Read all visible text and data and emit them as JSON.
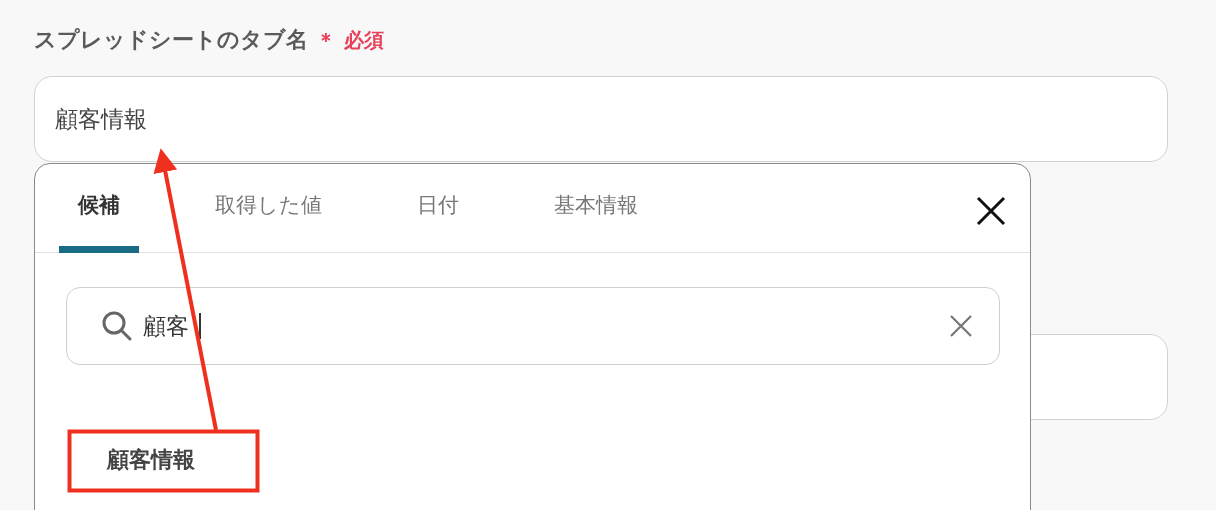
{
  "field": {
    "label": "スプレッドシートのタブ名",
    "required_mark": "＊",
    "required_text": "必須",
    "value": "顧客情報"
  },
  "popup": {
    "tabs": [
      {
        "label": "候補",
        "selected": true
      },
      {
        "label": "取得した値",
        "selected": false
      },
      {
        "label": "日付",
        "selected": false
      },
      {
        "label": "基本情報",
        "selected": false
      }
    ],
    "search": {
      "value": "顧客"
    },
    "results": [
      "顧客情報"
    ]
  }
}
